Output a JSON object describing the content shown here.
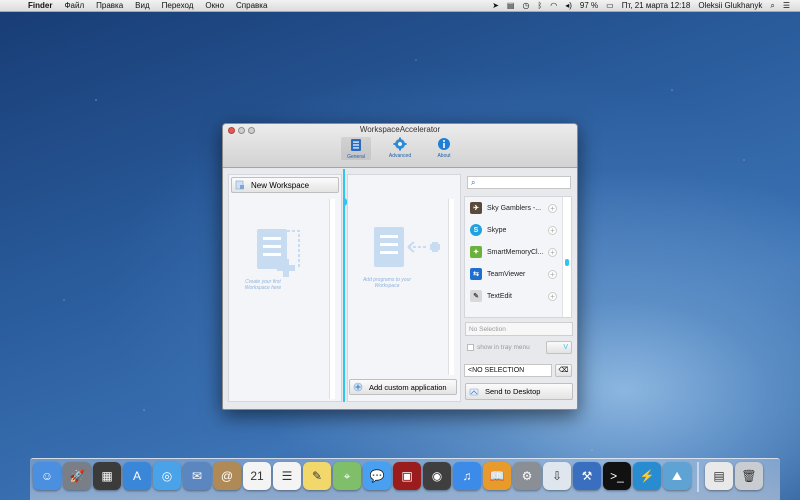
{
  "menubar": {
    "apple": "",
    "app": "Finder",
    "items": [
      "Файл",
      "Правка",
      "Вид",
      "Переход",
      "Окно",
      "Справка"
    ],
    "battery": "97 %",
    "datetime": "Пт, 21 марта  12:18",
    "user": "Oleksii Glukhanyk"
  },
  "window": {
    "title": "WorkspaceAccelerator",
    "toolbar": [
      {
        "label": "General",
        "icon": "list-icon"
      },
      {
        "label": "Advanced",
        "icon": "gear-icon"
      },
      {
        "label": "About",
        "icon": "info-icon"
      }
    ],
    "left": {
      "new_workspace": "New Workspace",
      "placeholder": "Create your first Workspace here"
    },
    "middle": {
      "placeholder": "Add programs to your Workspace",
      "add_custom": "Add custom application"
    },
    "right": {
      "search_placeholder": "",
      "apps": [
        {
          "name": "Sky Gamblers -...",
          "color": "#5a4a3a",
          "glyph": "✈"
        },
        {
          "name": "Skype",
          "color": "#1fa2e0",
          "glyph": "S"
        },
        {
          "name": "SmartMemoryCl...",
          "color": "#6bb13c",
          "glyph": "✦"
        },
        {
          "name": "TeamViewer",
          "color": "#1d6fd0",
          "glyph": "⇆"
        },
        {
          "name": "TextEdit",
          "color": "#d8d8d8",
          "glyph": "✎"
        }
      ],
      "no_selection": "No Selection",
      "show_tray": "show in tray menu",
      "v_label": "V",
      "no_selection_caps": "<NO SELECTION",
      "clear_glyph": "⌫",
      "send_to_desktop": "Send to Desktop"
    }
  },
  "dock": {
    "icons": [
      {
        "name": "finder",
        "color": "#4a8fe0",
        "glyph": "☺"
      },
      {
        "name": "launchpad",
        "color": "#7a7f87",
        "glyph": "🚀"
      },
      {
        "name": "mission-control",
        "color": "#3b3b3b",
        "glyph": "▦"
      },
      {
        "name": "app-store",
        "color": "#3a86d8",
        "glyph": "A"
      },
      {
        "name": "safari",
        "color": "#4aa3e8",
        "glyph": "◎"
      },
      {
        "name": "mail",
        "color": "#5b86c0",
        "glyph": "✉"
      },
      {
        "name": "contacts",
        "color": "#b08a56",
        "glyph": "@"
      },
      {
        "name": "calendar",
        "color": "#f4f4f4",
        "glyph": "21"
      },
      {
        "name": "reminders",
        "color": "#f4f4f4",
        "glyph": "☰"
      },
      {
        "name": "notes",
        "color": "#f2d86b",
        "glyph": "✎"
      },
      {
        "name": "maps",
        "color": "#7fbf6a",
        "glyph": "⌖"
      },
      {
        "name": "messages",
        "color": "#4aa0f0",
        "glyph": "💬"
      },
      {
        "name": "photo-booth",
        "color": "#9b1c1c",
        "glyph": "▣"
      },
      {
        "name": "facetime",
        "color": "#3f3f3f",
        "glyph": "◉"
      },
      {
        "name": "itunes",
        "color": "#3d8be8",
        "glyph": "♫"
      },
      {
        "name": "ibooks",
        "color": "#e89a2a",
        "glyph": "📖"
      },
      {
        "name": "system-preferences",
        "color": "#8a8f96",
        "glyph": "⚙"
      },
      {
        "name": "downloads",
        "color": "#dfe6ee",
        "glyph": "⇩"
      },
      {
        "name": "xcode",
        "color": "#3a6fc0",
        "glyph": "⚒"
      },
      {
        "name": "terminal",
        "color": "#111111",
        "glyph": ">_"
      },
      {
        "name": "workspace-accelerator",
        "color": "#2a8cd0",
        "glyph": "⚡"
      },
      {
        "name": "preview",
        "color": "#5fa3d4",
        "glyph": "⛰"
      },
      {
        "name": "documents",
        "color": "#e9e9e9",
        "glyph": "▤"
      },
      {
        "name": "trash",
        "color": "#c9ccd0",
        "glyph": "🗑"
      }
    ]
  }
}
